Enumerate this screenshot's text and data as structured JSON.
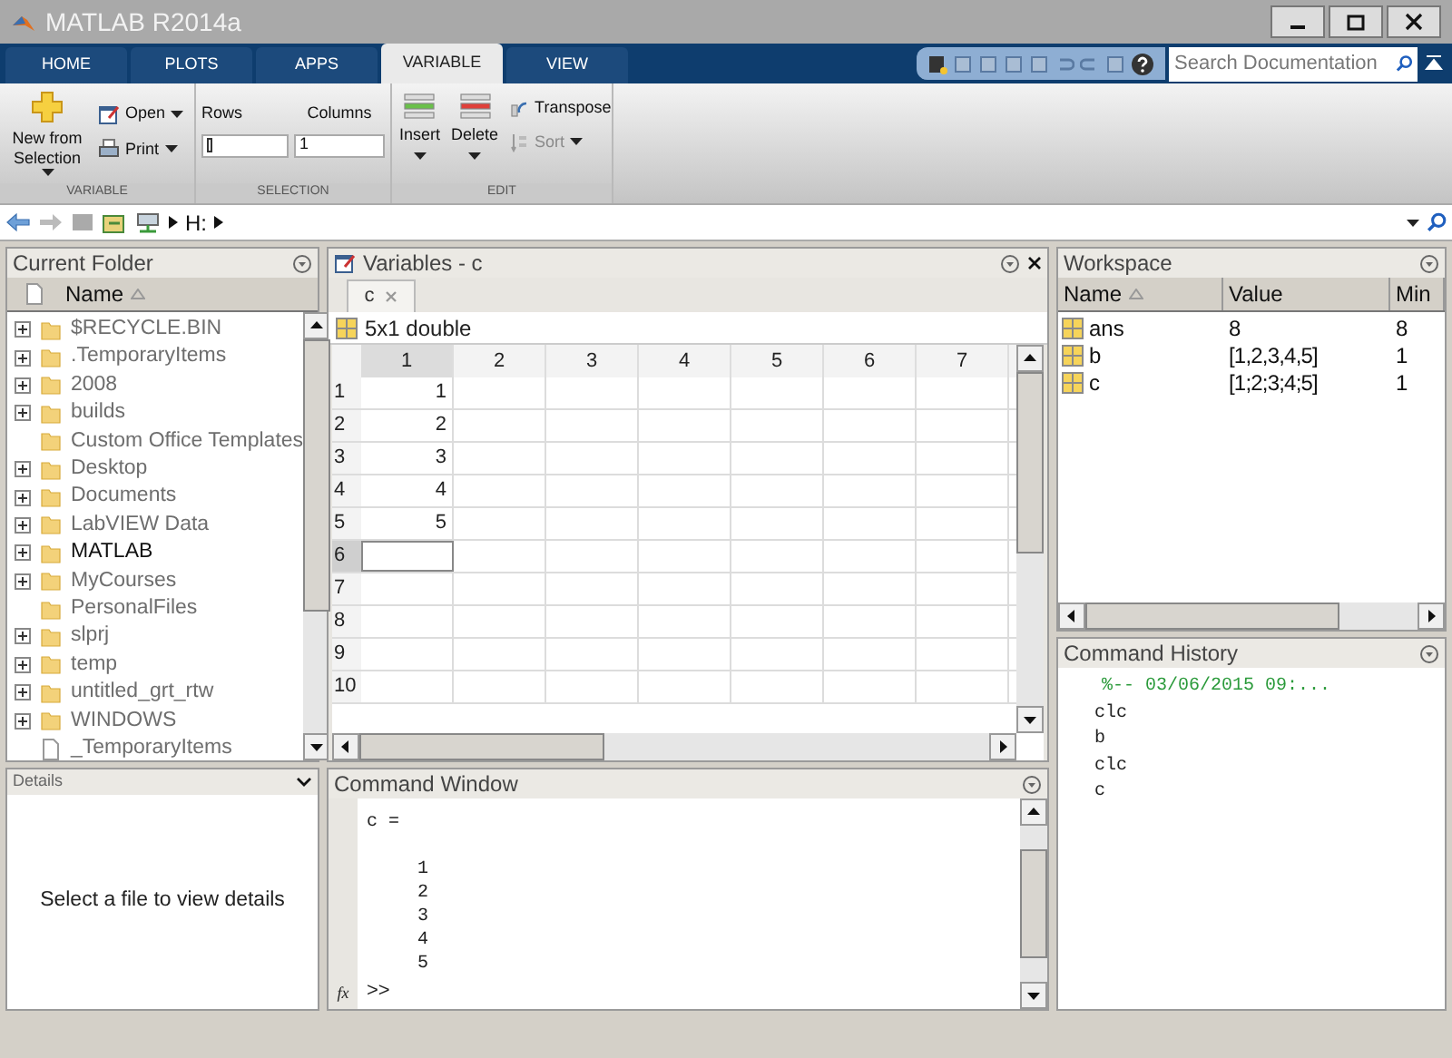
{
  "window": {
    "title": "MATLAB R2014a"
  },
  "tabs": [
    {
      "label": "HOME",
      "selected": false
    },
    {
      "label": "PLOTS",
      "selected": false
    },
    {
      "label": "APPS",
      "selected": false
    },
    {
      "label": "VARIABLE",
      "selected": true
    },
    {
      "label": "VIEW",
      "selected": false
    }
  ],
  "search": {
    "placeholder": "Search Documentation"
  },
  "ribbon": {
    "variable_group": {
      "label": "VARIABLE",
      "new_button": "New from Selection",
      "open_button": "Open",
      "print_button": "Print"
    },
    "selection_group": {
      "label": "SELECTION",
      "rows_label": "Rows",
      "columns_label": "Columns",
      "columns_value": "1"
    },
    "edit_group": {
      "label": "EDIT",
      "insert_button": "Insert",
      "delete_button": "Delete",
      "transpose_button": {
        "label": "Transpose",
        "disabled": false
      },
      "sort_button": {
        "label": "Sort",
        "disabled": true
      }
    }
  },
  "address_bar": {
    "path": "H:"
  },
  "current_folder": {
    "title": "Current Folder",
    "column": "Name",
    "items": [
      {
        "name": "$RECYCLE.BIN",
        "kind": "folder",
        "expandable": true,
        "current": false
      },
      {
        "name": ".TemporaryItems",
        "kind": "folder",
        "expandable": true,
        "current": false
      },
      {
        "name": "2008",
        "kind": "folder",
        "expandable": true,
        "current": false
      },
      {
        "name": "builds",
        "kind": "folder",
        "expandable": true,
        "current": false
      },
      {
        "name": "Custom Office Templates",
        "kind": "folder",
        "expandable": false,
        "current": false
      },
      {
        "name": "Desktop",
        "kind": "folder",
        "expandable": true,
        "current": false
      },
      {
        "name": "Documents",
        "kind": "folder",
        "expandable": true,
        "current": false
      },
      {
        "name": "LabVIEW Data",
        "kind": "folder",
        "expandable": true,
        "current": false
      },
      {
        "name": "MATLAB",
        "kind": "folder",
        "expandable": true,
        "current": true
      },
      {
        "name": "MyCourses",
        "kind": "folder",
        "expandable": true,
        "current": false
      },
      {
        "name": "PersonalFiles",
        "kind": "folder",
        "expandable": false,
        "current": false
      },
      {
        "name": "slprj",
        "kind": "folder",
        "expandable": true,
        "current": false
      },
      {
        "name": "temp",
        "kind": "folder",
        "expandable": true,
        "current": false
      },
      {
        "name": "untitled_grt_rtw",
        "kind": "folder",
        "expandable": true,
        "current": false
      },
      {
        "name": "WINDOWS",
        "kind": "folder",
        "expandable": true,
        "current": false
      },
      {
        "name": "_TemporaryItems",
        "kind": "file",
        "expandable": false,
        "current": false
      }
    ]
  },
  "details": {
    "title": "Details",
    "message": "Select a file to view details"
  },
  "variables": {
    "title": "Variables - c",
    "tab": "c",
    "info": "5x1 double",
    "columns": [
      "1",
      "2",
      "3",
      "4",
      "5",
      "6",
      "7"
    ],
    "rows": [
      {
        "label": "1",
        "cells": [
          "1"
        ],
        "selected": false
      },
      {
        "label": "2",
        "cells": [
          "2"
        ],
        "selected": false
      },
      {
        "label": "3",
        "cells": [
          "3"
        ],
        "selected": false
      },
      {
        "label": "4",
        "cells": [
          "4"
        ],
        "selected": false
      },
      {
        "label": "5",
        "cells": [
          "5"
        ],
        "selected": false
      },
      {
        "label": "6",
        "cells": [],
        "selected": true
      },
      {
        "label": "7",
        "cells": [],
        "selected": false
      },
      {
        "label": "8",
        "cells": [],
        "selected": false
      },
      {
        "label": "9",
        "cells": [],
        "selected": false
      },
      {
        "label": "10",
        "cells": [],
        "selected": false
      }
    ]
  },
  "command_window": {
    "title": "Command Window",
    "function_button": "fx",
    "lines": [
      {
        "text": "c =",
        "kind": "assignment"
      },
      {
        "text": "1",
        "kind": "value"
      },
      {
        "text": "2",
        "kind": "value"
      },
      {
        "text": "3",
        "kind": "value"
      },
      {
        "text": "4",
        "kind": "value"
      },
      {
        "text": "5",
        "kind": "value"
      }
    ],
    "prompt": ">>"
  },
  "workspace": {
    "title": "Workspace",
    "columns": [
      "Name",
      "Value",
      "Min"
    ],
    "rows": [
      {
        "name": "ans",
        "value": "8",
        "min": "8"
      },
      {
        "name": "b",
        "value": "[1,2,3,4,5]",
        "min": "1"
      },
      {
        "name": "c",
        "value": "[1;2;3;4;5]",
        "min": "1"
      }
    ]
  },
  "command_history": {
    "title": "Command History",
    "entries": [
      {
        "text": "%-- 03/06/2015 09:...",
        "kind": "session"
      },
      {
        "text": "clc",
        "kind": "command"
      },
      {
        "text": "b",
        "kind": "command"
      },
      {
        "text": "clc",
        "kind": "command"
      },
      {
        "text": "c",
        "kind": "command"
      }
    ]
  }
}
